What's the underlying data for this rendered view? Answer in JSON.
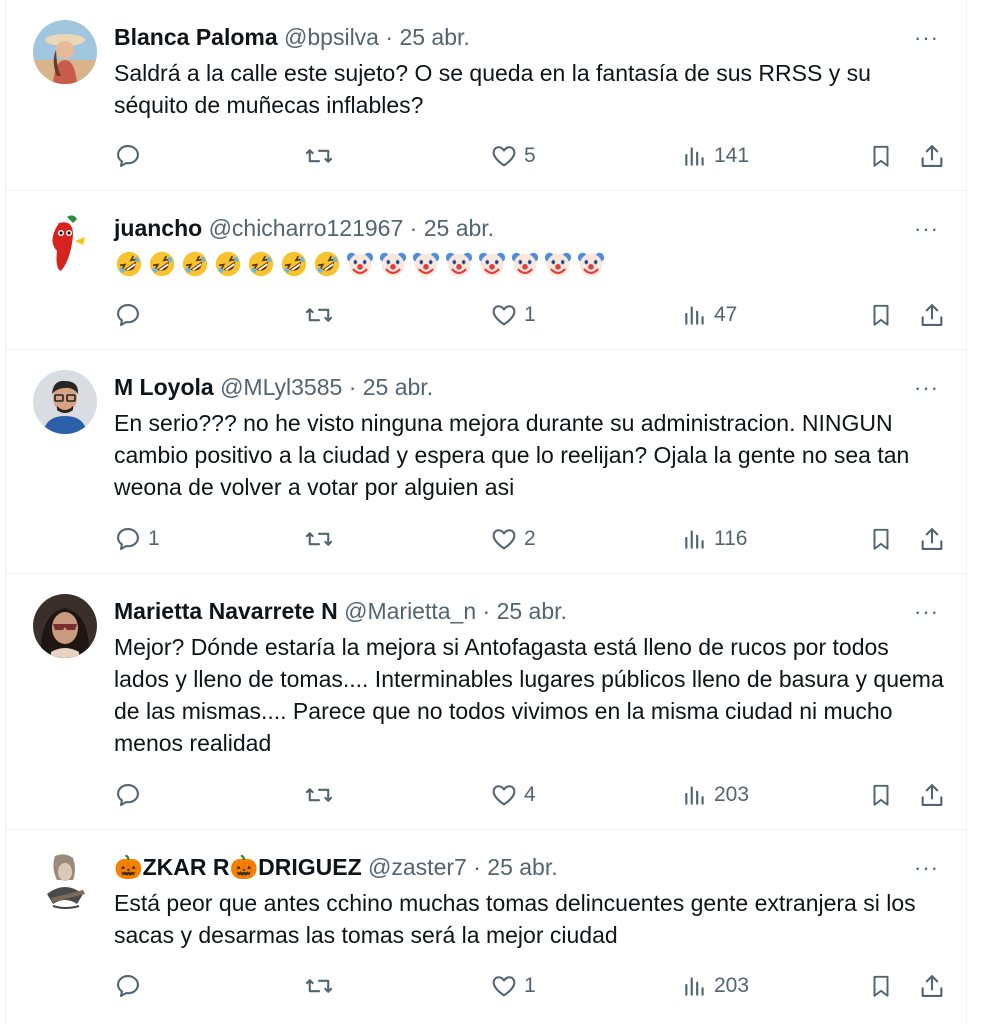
{
  "tweets": [
    {
      "name": "Blanca Paloma",
      "handle": "@bpsilva",
      "sep": "·",
      "date": "25 abr.",
      "text": "Saldrá a la calle este sujeto? O se queda en la fantasía de sus RRSS y su séquito de muñecas inflables?",
      "replies": "",
      "retweets": "",
      "likes": "5",
      "views": "141",
      "more": "···"
    },
    {
      "name": "juancho",
      "handle": "@chicharro121967",
      "sep": "·",
      "date": "25 abr.",
      "text": "",
      "emojis": [
        "rofl",
        "rofl",
        "rofl",
        "rofl",
        "rofl",
        "rofl",
        "rofl",
        "clown",
        "clown",
        "clown",
        "clown",
        "clown",
        "clown",
        "clown",
        "clown"
      ],
      "replies": "",
      "retweets": "",
      "likes": "1",
      "views": "47",
      "more": "···"
    },
    {
      "name": "M Loyola",
      "handle": "@MLyl3585",
      "sep": "·",
      "date": "25 abr.",
      "text": "En serio??? no he visto ninguna mejora durante su administracion. NINGUN cambio positivo a la ciudad y espera que lo reelijan? Ojala la gente no sea tan weona de volver a votar por alguien asi",
      "replies": "1",
      "retweets": "",
      "likes": "2",
      "views": "116",
      "more": "···"
    },
    {
      "name": "Marietta Navarrete N",
      "handle": "@Marietta_n",
      "sep": "·",
      "date": "25 abr.",
      "text": "Mejor? Dónde estaría la mejora si Antofagasta está lleno de rucos por todos lados y lleno de tomas.... Interminables lugares públicos lleno de basura y quema de las mismas.... Parece que no todos vivimos en la misma ciudad ni mucho menos realidad",
      "replies": "",
      "retweets": "",
      "likes": "4",
      "views": "203",
      "more": "···"
    },
    {
      "name": "🎃ZKAR R🎃DRIGUEZ",
      "handle": "@zaster7",
      "sep": "·",
      "date": "25 abr.",
      "text": "Está peor que antes cchino muchas tomas delincuentes gente extranjera si los sacas y desarmas las tomas será la mejor ciudad",
      "replies": "",
      "retweets": "",
      "likes": "1",
      "views": "203",
      "more": "···"
    }
  ],
  "colors": {
    "text": "#0f1419",
    "secondary": "#536471",
    "border": "#eff3f4"
  },
  "icons": [
    "reply-icon",
    "retweet-icon",
    "like-icon",
    "views-icon",
    "bookmark-icon",
    "share-icon",
    "more-icon"
  ]
}
